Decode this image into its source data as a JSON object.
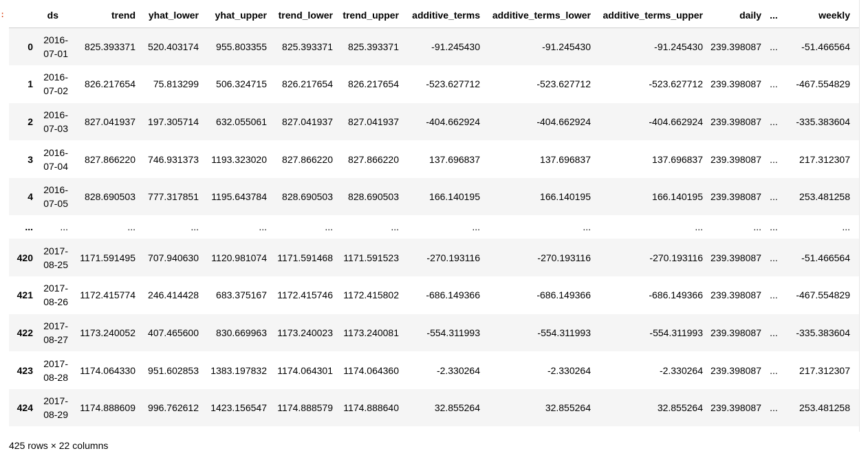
{
  "prompt_mark": ":",
  "table": {
    "columns": [
      "",
      "ds",
      "trend",
      "yhat_lower",
      "yhat_upper",
      "trend_lower",
      "trend_upper",
      "additive_terms",
      "additive_terms_lower",
      "additive_terms_upper",
      "daily",
      "...",
      "weekly"
    ],
    "rows": [
      {
        "index": "0",
        "ds_year": "2016-",
        "ds_md": "07-01",
        "cells": [
          "825.393371",
          "520.403174",
          "955.803355",
          "825.393371",
          "825.393371",
          "-91.245430",
          "-91.245430",
          "-91.245430",
          "239.398087",
          "...",
          "-51.466564"
        ]
      },
      {
        "index": "1",
        "ds_year": "2016-",
        "ds_md": "07-02",
        "cells": [
          "826.217654",
          "75.813299",
          "506.324715",
          "826.217654",
          "826.217654",
          "-523.627712",
          "-523.627712",
          "-523.627712",
          "239.398087",
          "...",
          "-467.554829"
        ]
      },
      {
        "index": "2",
        "ds_year": "2016-",
        "ds_md": "07-03",
        "cells": [
          "827.041937",
          "197.305714",
          "632.055061",
          "827.041937",
          "827.041937",
          "-404.662924",
          "-404.662924",
          "-404.662924",
          "239.398087",
          "...",
          "-335.383604"
        ]
      },
      {
        "index": "3",
        "ds_year": "2016-",
        "ds_md": "07-04",
        "cells": [
          "827.866220",
          "746.931373",
          "1193.323020",
          "827.866220",
          "827.866220",
          "137.696837",
          "137.696837",
          "137.696837",
          "239.398087",
          "...",
          "217.312307"
        ]
      },
      {
        "index": "4",
        "ds_year": "2016-",
        "ds_md": "07-05",
        "cells": [
          "828.690503",
          "777.317851",
          "1195.643784",
          "828.690503",
          "828.690503",
          "166.140195",
          "166.140195",
          "166.140195",
          "239.398087",
          "...",
          "253.481258"
        ]
      },
      {
        "ellipsis": true,
        "index": "...",
        "ds_year": "...",
        "ds_md": "",
        "cells": [
          "...",
          "...",
          "...",
          "...",
          "...",
          "...",
          "...",
          "...",
          "...",
          "...",
          "..."
        ]
      },
      {
        "index": "420",
        "ds_year": "2017-",
        "ds_md": "08-25",
        "cells": [
          "1171.591495",
          "707.940630",
          "1120.981074",
          "1171.591468",
          "1171.591523",
          "-270.193116",
          "-270.193116",
          "-270.193116",
          "239.398087",
          "...",
          "-51.466564"
        ]
      },
      {
        "index": "421",
        "ds_year": "2017-",
        "ds_md": "08-26",
        "cells": [
          "1172.415774",
          "246.414428",
          "683.375167",
          "1172.415746",
          "1172.415802",
          "-686.149366",
          "-686.149366",
          "-686.149366",
          "239.398087",
          "...",
          "-467.554829"
        ]
      },
      {
        "index": "422",
        "ds_year": "2017-",
        "ds_md": "08-27",
        "cells": [
          "1173.240052",
          "407.465600",
          "830.669963",
          "1173.240023",
          "1173.240081",
          "-554.311993",
          "-554.311993",
          "-554.311993",
          "239.398087",
          "...",
          "-335.383604"
        ]
      },
      {
        "index": "423",
        "ds_year": "2017-",
        "ds_md": "08-28",
        "cells": [
          "1174.064330",
          "951.602853",
          "1383.197832",
          "1174.064301",
          "1174.064360",
          "-2.330264",
          "-2.330264",
          "-2.330264",
          "239.398087",
          "...",
          "217.312307"
        ]
      },
      {
        "index": "424",
        "ds_year": "2017-",
        "ds_md": "08-29",
        "cells": [
          "1174.888609",
          "996.762612",
          "1423.156547",
          "1174.888579",
          "1174.888640",
          "32.855264",
          "32.855264",
          "32.855264",
          "239.398087",
          "...",
          "253.481258"
        ]
      }
    ]
  },
  "footer": "425 rows × 22 columns"
}
